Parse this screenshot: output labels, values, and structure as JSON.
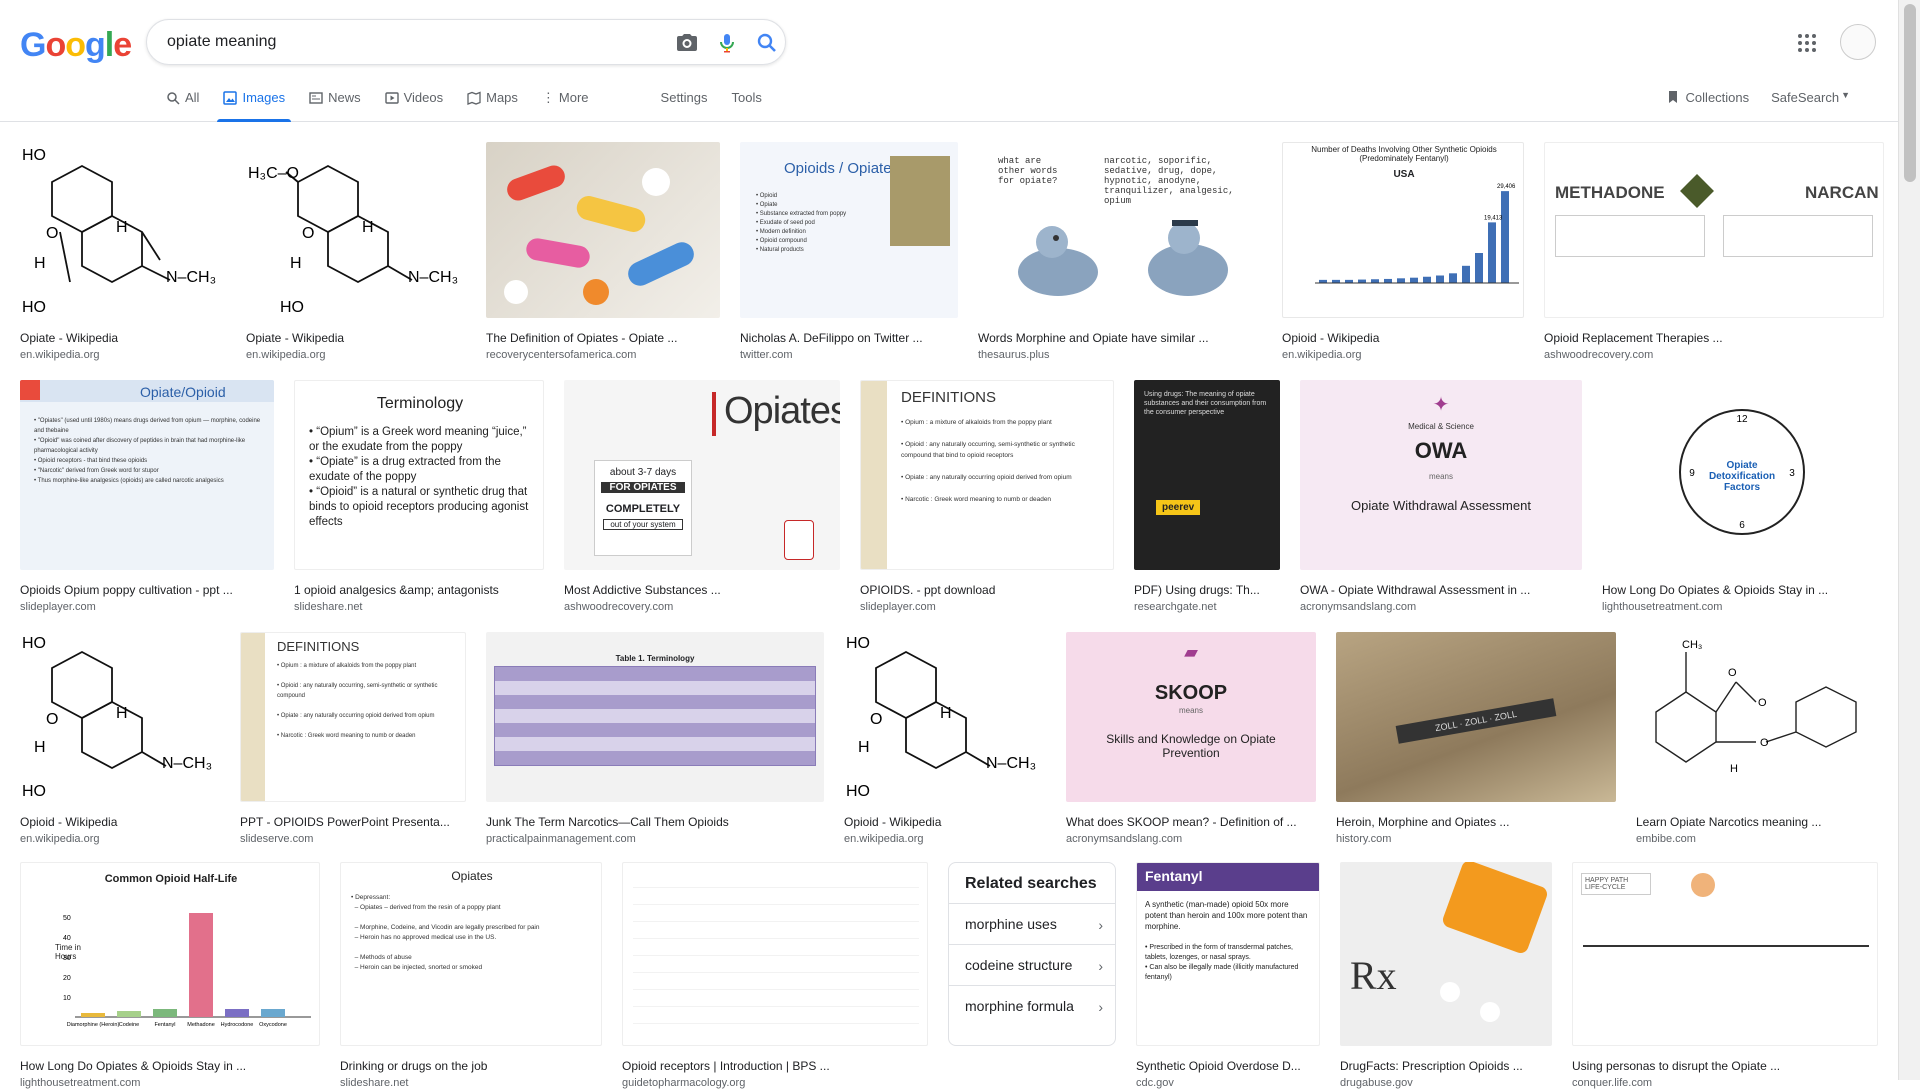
{
  "search": {
    "query": "opiate meaning"
  },
  "logo_letters": [
    {
      "t": "G",
      "c": "#4285f4"
    },
    {
      "t": "o",
      "c": "#ea4335"
    },
    {
      "t": "o",
      "c": "#fbbc05"
    },
    {
      "t": "g",
      "c": "#4285f4"
    },
    {
      "t": "l",
      "c": "#34a853"
    },
    {
      "t": "e",
      "c": "#ea4335"
    }
  ],
  "tabs": {
    "all": "All",
    "images": "Images",
    "news": "News",
    "videos": "Videos",
    "maps": "Maps",
    "more": "More",
    "settings": "Settings",
    "tools": "Tools"
  },
  "right_tools": {
    "collections": "Collections",
    "safesearch": "SafeSearch"
  },
  "rows": [
    [
      {
        "caption": "Opiate - Wikipedia",
        "source": "en.wikipedia.org"
      },
      {
        "caption": "Opiate - Wikipedia",
        "source": "en.wikipedia.org"
      },
      {
        "caption": "The Definition of Opiates - Opiate ...",
        "source": "recoverycentersofamerica.com"
      },
      {
        "caption": "Nicholas A. DeFilippo on Twitter ...",
        "source": "twitter.com"
      },
      {
        "caption": "Words Morphine and Opiate have similar ...",
        "source": "thesaurus.plus"
      },
      {
        "caption": "Opioid - Wikipedia",
        "source": "en.wikipedia.org"
      },
      {
        "caption": "Opioid Replacement Therapies ...",
        "source": "ashwoodrecovery.com"
      }
    ],
    [
      {
        "caption": "Opioids Opium poppy cultivation - ppt ...",
        "source": "slideplayer.com"
      },
      {
        "caption": "1 opioid analgesics &amp; antagonists",
        "source": "slideshare.net"
      },
      {
        "caption": "Most Addictive Substances ...",
        "source": "ashwoodrecovery.com"
      },
      {
        "caption": "OPIOIDS. - ppt download",
        "source": "slideplayer.com"
      },
      {
        "caption": "PDF) Using drugs: Th...",
        "source": "researchgate.net"
      },
      {
        "caption": "OWA - Opiate Withdrawal Assessment in ...",
        "source": "acronymsandslang.com"
      },
      {
        "caption": "How Long Do Opiates & Opioids Stay in ...",
        "source": "lighthousetreatment.com"
      }
    ],
    [
      {
        "caption": "Opioid - Wikipedia",
        "source": "en.wikipedia.org"
      },
      {
        "caption": "PPT - OPIOIDS PowerPoint Presenta...",
        "source": "slideserve.com"
      },
      {
        "caption": "Junk The Term Narcotics—Call Them Opioids",
        "source": "practicalpainmanagement.com"
      },
      {
        "caption": "Opioid - Wikipedia",
        "source": "en.wikipedia.org"
      },
      {
        "caption": "What does SKOOP mean? - Definition of ...",
        "source": "acronymsandslang.com"
      },
      {
        "caption": "Heroin, Morphine and Opiates ...",
        "source": "history.com"
      },
      {
        "caption": "Learn Opiate Narcotics meaning ...",
        "source": "embibe.com"
      }
    ],
    [
      {
        "caption": "How Long Do Opiates & Opioids Stay in ...",
        "source": "lighthousetreatment.com"
      },
      {
        "caption": "Drinking or drugs on the job",
        "source": "slideshare.net"
      },
      {
        "caption": "Opioid receptors | Introduction | BPS ...",
        "source": "guidetopharmacology.org"
      },
      {
        "caption": "Synthetic Opioid Overdose D...",
        "source": "cdc.gov"
      },
      {
        "caption": "DrugFacts: Prescription Opioids ...",
        "source": "drugabuse.gov"
      },
      {
        "caption": "Using personas to disrupt the Opiate ...",
        "source": "conquer.life.com"
      }
    ]
  ],
  "thumb_text": {
    "opioids_opiates": "Opioids / Opiates",
    "what_other": "what are other words for opiate?",
    "narcotic_list": "narcotic, soporific, sedative, drug, dope, hypnotic, anodyne, tranquilizer, analgesic, opium",
    "deaths_title": "Number of Deaths Involving Other Synthetic Opioids (Predominately Fentanyl)",
    "usa": "USA",
    "methadone": "METHADONE",
    "narcan": "NARCAN",
    "opiate_opioid": "Opiate/Opioid",
    "terminology": "Terminology",
    "term1": "“Opium” is a Greek word meaning “juice,” or the exudate from the poppy",
    "term2": "“Opiate” is a drug extracted from the exudate of the poppy",
    "term3": "“Opioid” is a natural or synthetic drug that binds to opioid receptors producing agonist effects",
    "opiates": "Opiates",
    "about_days": "about 3-7 days",
    "for_opiates": "FOR OPIATES",
    "completely": "COMPLETELY",
    "out_system": "out of your system",
    "definitions": "DEFINITIONS",
    "peerev": "peerev",
    "owa": "OWA",
    "means": "means",
    "owa_full": "Opiate Withdrawal Assessment",
    "medical_science": "Medical & Science",
    "detox": "Opiate Detoxification Factors",
    "table_title": "Table 1. Terminology",
    "skoop": "SKOOP",
    "skoop_full": "Skills and Knowledge on Opiate Prevention",
    "halflife_title": "Common Opioid Half-Life",
    "time_hours": "Time in Hours",
    "opiates_slide": "Opiates",
    "fentanyl": "Fentanyl",
    "fentanyl_text": "A synthetic (man-made) opioid 50x more potent than heroin and 100x more potent than morphine.",
    "rx": "Rx",
    "happy_path": "HAPPY PATH LIFE-CYCLE"
  },
  "related": {
    "title": "Related searches",
    "items": [
      "morphine uses",
      "codeine structure",
      "morphine formula"
    ]
  },
  "halflife_chart": {
    "categories": [
      "Diamorphine (Heroin)",
      "Codeine",
      "Fentanyl",
      "Methadone",
      "Hydrocodone",
      "Oxycodone"
    ],
    "values": [
      2,
      3,
      4,
      52,
      4,
      4
    ],
    "colors": [
      "#e8b93c",
      "#a6d08a",
      "#7cb87c",
      "#e2708b",
      "#7b6fc4",
      "#6aa8cf"
    ],
    "yticks": [
      "10",
      "20",
      "30",
      "40",
      "50"
    ]
  },
  "deaths_chart": {
    "values": [
      1,
      1,
      1,
      1.1,
      1.2,
      1.3,
      1.5,
      1.7,
      2,
      2.4,
      3.1,
      5.5,
      9.6,
      19.4,
      29.4
    ],
    "labels": [
      "19,413",
      "29,406"
    ]
  }
}
